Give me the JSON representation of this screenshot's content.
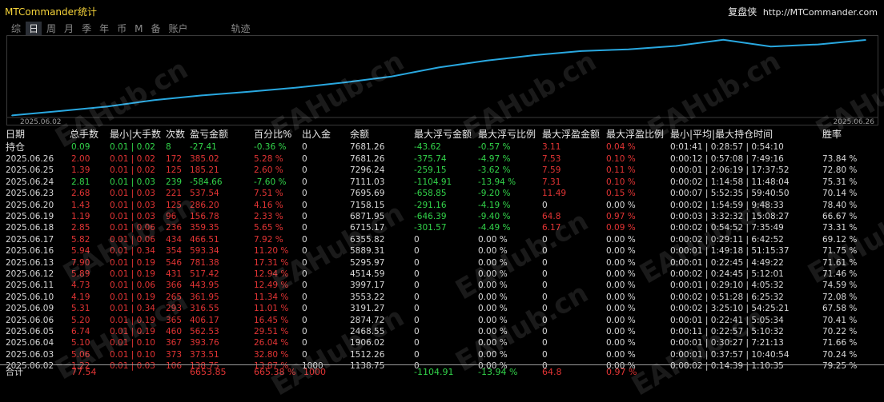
{
  "app": {
    "title": "MTCommander统计",
    "brand_cn": "复盘侠",
    "brand_url": "http://MTCommander.com"
  },
  "tabs": [
    {
      "label": "综",
      "active": false
    },
    {
      "label": "日",
      "active": true
    },
    {
      "label": "周",
      "active": false
    },
    {
      "label": "月",
      "active": false
    },
    {
      "label": "季",
      "active": false
    },
    {
      "label": "年",
      "active": false
    },
    {
      "label": "币",
      "active": false
    },
    {
      "label": "M",
      "active": false
    },
    {
      "label": "备",
      "active": false
    },
    {
      "label": "账户",
      "active": false
    },
    {
      "label": "轨迹",
      "active": false
    }
  ],
  "chart": {
    "x_start_label": "2025.06.02",
    "x_end_label": "2025.06.26",
    "line_color": "#29a8e0"
  },
  "chart_data": {
    "type": "line",
    "x": [
      "2025.06.02",
      "2025.06.03",
      "2025.06.04",
      "2025.06.05",
      "2025.06.06",
      "2025.06.09",
      "2025.06.10",
      "2025.06.11",
      "2025.06.12",
      "2025.06.13",
      "2025.06.16",
      "2025.06.17",
      "2025.06.18",
      "2025.06.19",
      "2025.06.20",
      "2025.06.23",
      "2025.06.24",
      "2025.06.25",
      "2025.06.26"
    ],
    "series": [
      {
        "values": [
          1138.75,
          1512.26,
          1906.02,
          2468.55,
          2874.72,
          3191.27,
          3553.22,
          3997.17,
          4514.59,
          5295.97,
          5889.31,
          6355.82,
          6715.17,
          6871.95,
          7158.15,
          7695.69,
          7111.03,
          7296.24,
          7681.26
        ]
      }
    ]
  },
  "table": {
    "headers": {
      "date": "日期",
      "lots": "总手数",
      "minmax": "最小|大手数",
      "count": "次数",
      "pl": "盈亏金额",
      "pct": "百分比%",
      "io": "出入金",
      "balance": "余额",
      "maxfl": "最大浮亏金额",
      "maxflr": "最大浮亏比例",
      "maxfp": "最大浮盈金额",
      "maxfpr": "最大浮盈比例",
      "hold": "最小|平均|最大持仓时间",
      "win": "胜率"
    },
    "holding": {
      "label": "持仓",
      "lots": "0.09",
      "minmax": "0.01 | 0.02",
      "count": "8",
      "pl": "-27.41",
      "pct": "-0.36 %",
      "io": "0",
      "balance": "7681.26",
      "maxfl": "-43.62",
      "maxflr": "-0.57 %",
      "maxfp": "3.11",
      "maxfpr": "0.04 %",
      "hold": "0:01:41 | 0:28:57 | 0:54:10",
      "win": ""
    },
    "rows": [
      {
        "date": "2025.06.26",
        "lots": "2.00",
        "minmax": "0.01 | 0.02",
        "count": "172",
        "pl": "385.02",
        "pct": "5.28 %",
        "io": "0",
        "balance": "7681.26",
        "maxfl": "-375.74",
        "maxflr": "-4.97 %",
        "maxfp": "7.53",
        "maxfpr": "0.10 %",
        "hold": "0:00:12 | 0:57:08 | 7:49:16",
        "win": "73.84 %",
        "pos": true
      },
      {
        "date": "2025.06.25",
        "lots": "1.39",
        "minmax": "0.01 | 0.02",
        "count": "125",
        "pl": "185.21",
        "pct": "2.60 %",
        "io": "0",
        "balance": "7296.24",
        "maxfl": "-259.15",
        "maxflr": "-3.62 %",
        "maxfp": "7.59",
        "maxfpr": "0.11 %",
        "hold": "0:00:01 | 2:06:19 | 17:37:52",
        "win": "72.80 %",
        "pos": true
      },
      {
        "date": "2025.06.24",
        "lots": "2.81",
        "minmax": "0.01 | 0.03",
        "count": "239",
        "pl": "-584.66",
        "pct": "-7.60 %",
        "io": "0",
        "balance": "7111.03",
        "maxfl": "-1104.91",
        "maxflr": "-13.94 %",
        "maxfp": "7.31",
        "maxfpr": "0.10 %",
        "hold": "0:00:02 | 1:14:58 | 11:48:04",
        "win": "75.31 %",
        "pos": false
      },
      {
        "date": "2025.06.23",
        "lots": "2.68",
        "minmax": "0.01 | 0.03",
        "count": "221",
        "pl": "537.54",
        "pct": "7.51 %",
        "io": "0",
        "balance": "7695.69",
        "maxfl": "-658.85",
        "maxflr": "-9.20 %",
        "maxfp": "11.49",
        "maxfpr": "0.15 %",
        "hold": "0:00:07 | 5:52:35 | 59:40:50",
        "win": "70.14 %",
        "pos": true
      },
      {
        "date": "2025.06.20",
        "lots": "1.43",
        "minmax": "0.01 | 0.03",
        "count": "125",
        "pl": "286.20",
        "pct": "4.16 %",
        "io": "0",
        "balance": "7158.15",
        "maxfl": "-291.16",
        "maxflr": "-4.19 %",
        "maxfp": "0",
        "maxfpr": "0.00 %",
        "hold": "0:00:02 | 1:54:59 | 9:48:33",
        "win": "78.40 %",
        "pos": true
      },
      {
        "date": "2025.06.19",
        "lots": "1.19",
        "minmax": "0.01 | 0.03",
        "count": "96",
        "pl": "156.78",
        "pct": "2.33 %",
        "io": "0",
        "balance": "6871.95",
        "maxfl": "-646.39",
        "maxflr": "-9.40 %",
        "maxfp": "64.8",
        "maxfpr": "0.97 %",
        "hold": "0:00:03 | 3:32:32 | 15:08:27",
        "win": "66.67 %",
        "pos": true
      },
      {
        "date": "2025.06.18",
        "lots": "2.85",
        "minmax": "0.01 | 0.06",
        "count": "236",
        "pl": "359.35",
        "pct": "5.65 %",
        "io": "0",
        "balance": "6715.17",
        "maxfl": "-301.57",
        "maxflr": "-4.49 %",
        "maxfp": "6.17",
        "maxfpr": "0.09 %",
        "hold": "0:00:02 | 0:54:52 | 7:35:49",
        "win": "73.31 %",
        "pos": true
      },
      {
        "date": "2025.06.17",
        "lots": "5.82",
        "minmax": "0.01 | 0.06",
        "count": "434",
        "pl": "466.51",
        "pct": "7.92 %",
        "io": "0",
        "balance": "6355.82",
        "maxfl": "0",
        "maxflr": "0.00 %",
        "maxfp": "0",
        "maxfpr": "0.00 %",
        "hold": "0:00:02 | 0:29:11 | 6:42:52",
        "win": "69.12 %",
        "pos": true
      },
      {
        "date": "2025.06.16",
        "lots": "5.94",
        "minmax": "0.01 | 0.34",
        "count": "354",
        "pl": "593.34",
        "pct": "11.20 %",
        "io": "0",
        "balance": "5889.31",
        "maxfl": "0",
        "maxflr": "0.00 %",
        "maxfp": "0",
        "maxfpr": "0.00 %",
        "hold": "0:00:01 | 1:49:18 | 51:15:37",
        "win": "71.75 %",
        "pos": true
      },
      {
        "date": "2025.06.13",
        "lots": "7.90",
        "minmax": "0.01 | 0.19",
        "count": "546",
        "pl": "781.38",
        "pct": "17.31 %",
        "io": "0",
        "balance": "5295.97",
        "maxfl": "0",
        "maxflr": "0.00 %",
        "maxfp": "0",
        "maxfpr": "0.00 %",
        "hold": "0:00:01 | 0:22:45 | 4:49:22",
        "win": "71.61 %",
        "pos": true
      },
      {
        "date": "2025.06.12",
        "lots": "5.89",
        "minmax": "0.01 | 0.19",
        "count": "431",
        "pl": "517.42",
        "pct": "12.94 %",
        "io": "0",
        "balance": "4514.59",
        "maxfl": "0",
        "maxflr": "0.00 %",
        "maxfp": "0",
        "maxfpr": "0.00 %",
        "hold": "0:00:02 | 0:24:45 | 5:12:01",
        "win": "71.46 %",
        "pos": true
      },
      {
        "date": "2025.06.11",
        "lots": "4.73",
        "minmax": "0.01 | 0.06",
        "count": "366",
        "pl": "443.95",
        "pct": "12.49 %",
        "io": "0",
        "balance": "3997.17",
        "maxfl": "0",
        "maxflr": "0.00 %",
        "maxfp": "0",
        "maxfpr": "0.00 %",
        "hold": "0:00:01 | 0:29:10 | 4:05:32",
        "win": "74.59 %",
        "pos": true
      },
      {
        "date": "2025.06.10",
        "lots": "4.19",
        "minmax": "0.01 | 0.19",
        "count": "265",
        "pl": "361.95",
        "pct": "11.34 %",
        "io": "0",
        "balance": "3553.22",
        "maxfl": "0",
        "maxflr": "0.00 %",
        "maxfp": "0",
        "maxfpr": "0.00 %",
        "hold": "0:00:02 | 0:51:28 | 6:25:32",
        "win": "72.08 %",
        "pos": true
      },
      {
        "date": "2025.06.09",
        "lots": "5.31",
        "minmax": "0.01 | 0.34",
        "count": "293",
        "pl": "316.55",
        "pct": "11.01 %",
        "io": "0",
        "balance": "3191.27",
        "maxfl": "0",
        "maxflr": "0.00 %",
        "maxfp": "0",
        "maxfpr": "0.00 %",
        "hold": "0:00:02 | 3:25:10 | 54:25:21",
        "win": "67.58 %",
        "pos": true
      },
      {
        "date": "2025.06.06",
        "lots": "5.20",
        "minmax": "0.01 | 0.19",
        "count": "365",
        "pl": "406.17",
        "pct": "16.45 %",
        "io": "0",
        "balance": "2874.72",
        "maxfl": "0",
        "maxflr": "0.00 %",
        "maxfp": "0",
        "maxfpr": "0.00 %",
        "hold": "0:00:01 | 0:22:41 | 5:05:34",
        "win": "70.41 %",
        "pos": true
      },
      {
        "date": "2025.06.05",
        "lots": "6.74",
        "minmax": "0.01 | 0.19",
        "count": "460",
        "pl": "562.53",
        "pct": "29.51 %",
        "io": "0",
        "balance": "2468.55",
        "maxfl": "0",
        "maxflr": "0.00 %",
        "maxfp": "0",
        "maxfpr": "0.00 %",
        "hold": "0:00:11 | 0:22:57 | 5:10:32",
        "win": "70.22 %",
        "pos": true
      },
      {
        "date": "2025.06.04",
        "lots": "5.10",
        "minmax": "0.01 | 0.10",
        "count": "367",
        "pl": "393.76",
        "pct": "26.04 %",
        "io": "0",
        "balance": "1906.02",
        "maxfl": "0",
        "maxflr": "0.00 %",
        "maxfp": "0",
        "maxfpr": "0.00 %",
        "hold": "0:00:01 | 0:30:27 | 7:21:13",
        "win": "71.66 %",
        "pos": true
      },
      {
        "date": "2025.06.03",
        "lots": "5.06",
        "minmax": "0.01 | 0.10",
        "count": "373",
        "pl": "373.51",
        "pct": "32.80 %",
        "io": "0",
        "balance": "1512.26",
        "maxfl": "0",
        "maxflr": "0.00 %",
        "maxfp": "0",
        "maxfpr": "0.00 %",
        "hold": "0:00:01 | 0:37:57 | 10:40:54",
        "win": "70.24 %",
        "pos": true
      },
      {
        "date": "2025.06.02",
        "lots": "1.22",
        "minmax": "0.01 | 0.03",
        "count": "106",
        "pl": "138.75",
        "pct": "13.87 %",
        "io": "1000",
        "balance": "1138.75",
        "maxfl": "0",
        "maxflr": "0.00 %",
        "maxfp": "0",
        "maxfpr": "0.00 %",
        "hold": "0:00:02 | 0:14:39 | 1:10:35",
        "win": "79.25 %",
        "pos": true
      }
    ],
    "total": {
      "label": "合计",
      "lots": "77.54",
      "pl": "6653.85",
      "pct": "665.38 %",
      "io": "1000",
      "maxfl": "-1104.91",
      "maxflr": "-13.94 %",
      "maxfp": "64.8",
      "maxfpr": "0.97 %"
    }
  },
  "watermark": "EAHub.cn"
}
